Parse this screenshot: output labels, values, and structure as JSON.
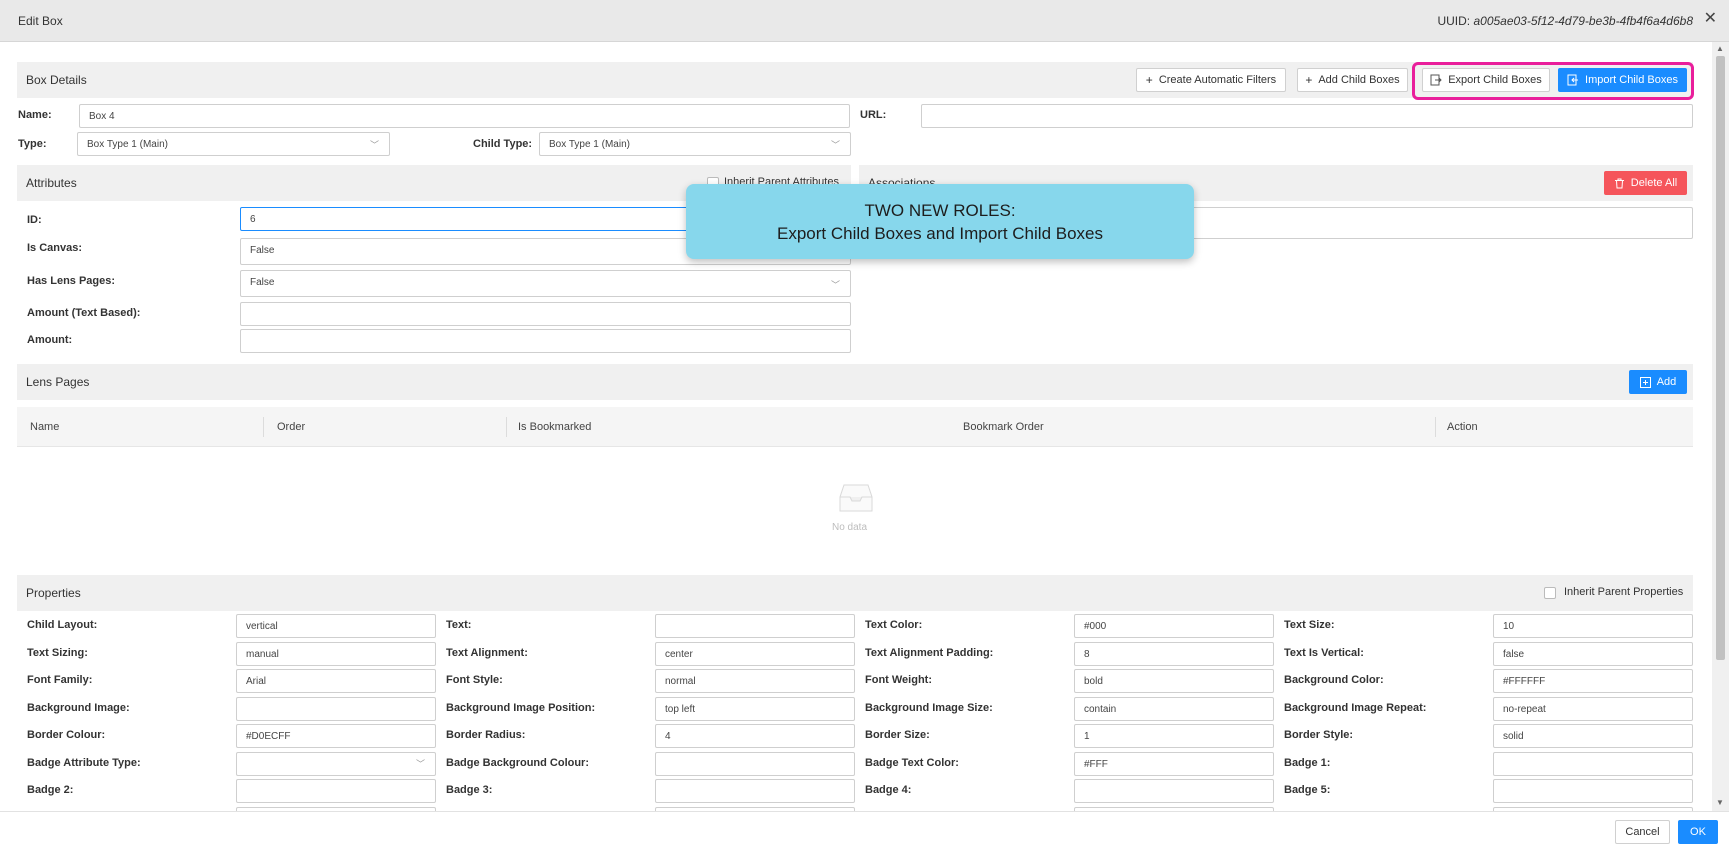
{
  "window": {
    "title": "Edit Box",
    "uuid_label": "UUID:",
    "uuid_value": "a005ae03-5f12-4d79-be3b-4fb4f6a4d6b8",
    "close_glyph": "✕"
  },
  "box_details": {
    "title": "Box Details",
    "buttons": {
      "create_filters": "Create Automatic Filters",
      "add_child": "Add Child Boxes",
      "export_child": "Export Child Boxes",
      "import_child": "Import Child Boxes"
    },
    "name_label": "Name:",
    "name_value": "Box 4",
    "url_label": "URL:",
    "url_value": "",
    "type_label": "Type:",
    "type_value": "Box Type 1 (Main)",
    "child_type_label": "Child Type:",
    "child_type_value": "Box Type 1 (Main)"
  },
  "attributes": {
    "title": "Attributes",
    "inherit_label": "Inherit Parent Attributes",
    "fields": [
      {
        "label": "ID:",
        "value": "6"
      },
      {
        "label": "Is Canvas:",
        "value": "False"
      },
      {
        "label": "Has Lens Pages:",
        "value": "False"
      },
      {
        "label": "Amount (Text Based):",
        "value": ""
      },
      {
        "label": "Amount:",
        "value": ""
      }
    ]
  },
  "associations": {
    "title": "Associations",
    "delete_all": "Delete All"
  },
  "callout": {
    "line1": "TWO NEW ROLES:",
    "line2": "Export Child Boxes and Import Child Boxes"
  },
  "lens_pages": {
    "title": "Lens Pages",
    "add": "Add",
    "columns": [
      "Name",
      "Order",
      "Is Bookmarked",
      "Bookmark Order",
      "Action"
    ],
    "empty_text": "No data"
  },
  "properties": {
    "title": "Properties",
    "inherit_label": "Inherit Parent Properties",
    "rows": [
      [
        {
          "label": "Child Layout:",
          "value": "vertical"
        },
        {
          "label": "Text:",
          "value": ""
        },
        {
          "label": "Text Color:",
          "value": "#000"
        },
        {
          "label": "Text Size:",
          "value": "10"
        }
      ],
      [
        {
          "label": "Text Sizing:",
          "value": "manual"
        },
        {
          "label": "Text Alignment:",
          "value": "center"
        },
        {
          "label": "Text Alignment Padding:",
          "value": "8"
        },
        {
          "label": "Text Is Vertical:",
          "value": "false"
        }
      ],
      [
        {
          "label": "Font Family:",
          "value": "Arial"
        },
        {
          "label": "Font Style:",
          "value": "normal"
        },
        {
          "label": "Font Weight:",
          "value": "bold"
        },
        {
          "label": "Background Color:",
          "value": "#FFFFFF"
        }
      ],
      [
        {
          "label": "Background Image:",
          "value": ""
        },
        {
          "label": "Background Image Position:",
          "value": "top left"
        },
        {
          "label": "Background Image Size:",
          "value": "contain"
        },
        {
          "label": "Background Image Repeat:",
          "value": "no-repeat"
        }
      ],
      [
        {
          "label": "Border Colour:",
          "value": "#D0ECFF"
        },
        {
          "label": "Border Radius:",
          "value": "4"
        },
        {
          "label": "Border Size:",
          "value": "1"
        },
        {
          "label": "Border Style:",
          "value": "solid"
        }
      ],
      [
        {
          "label": "Badge Attribute Type:",
          "value": ""
        },
        {
          "label": "Badge Background Colour:",
          "value": ""
        },
        {
          "label": "Badge Text Color:",
          "value": "#FFF"
        },
        {
          "label": "Badge 1:",
          "value": ""
        }
      ],
      [
        {
          "label": "Badge 2:",
          "value": ""
        },
        {
          "label": "Badge 3:",
          "value": ""
        },
        {
          "label": "Badge 4:",
          "value": ""
        },
        {
          "label": "Badge 5:",
          "value": ""
        }
      ]
    ]
  },
  "footer": {
    "cancel": "Cancel",
    "ok": "OK"
  },
  "colors": {
    "primary": "#1a8cff",
    "danger": "#f5555b",
    "callout": "#87d7ec",
    "highlight": "#e91e9b"
  }
}
